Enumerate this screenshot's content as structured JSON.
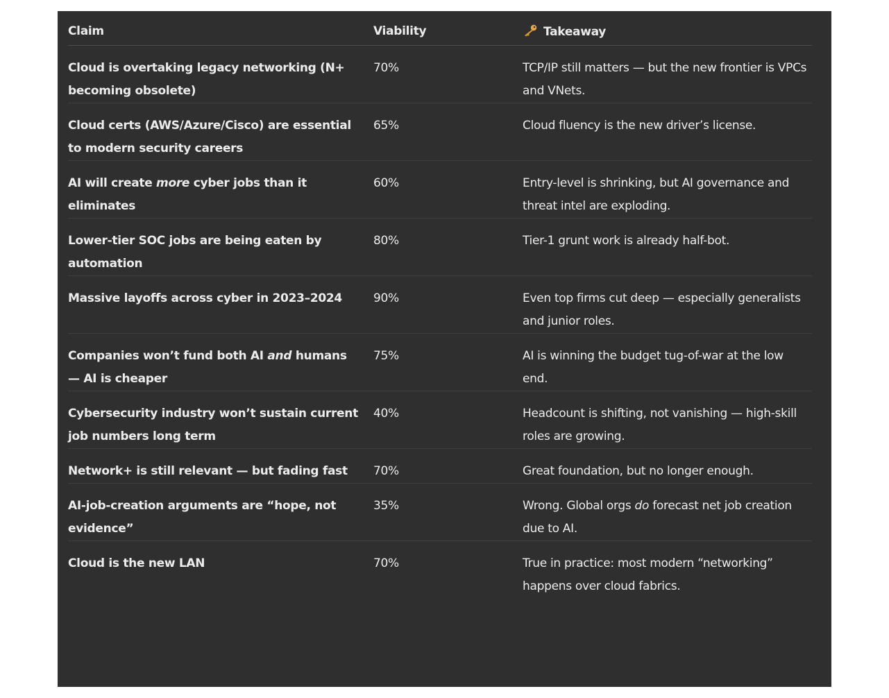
{
  "header": {
    "claim": "Claim",
    "viability": "Viability",
    "takeaway": "Takeaway",
    "takeaway_icon": "key-icon"
  },
  "rows": [
    {
      "claim": "Cloud is overtaking legacy networking (N+ becoming obsolete)",
      "viability": "70%",
      "takeaway": "TCP/IP still matters — but the new frontier is VPCs and VNets."
    },
    {
      "claim": "Cloud certs (AWS/Azure/Cisco) are essential to modern security careers",
      "viability": "65%",
      "takeaway": "Cloud fluency is the new driver’s license."
    },
    {
      "claim_pre": "AI will create ",
      "claim_em": "more",
      "claim_post": " cyber jobs than it eliminates",
      "viability": "60%",
      "takeaway": "Entry-level is shrinking, but AI governance and threat intel are exploding."
    },
    {
      "claim": "Lower-tier SOC jobs are being eaten by automation",
      "viability": "80%",
      "takeaway": "Tier-1 grunt work is already half-bot."
    },
    {
      "claim": "Massive layoffs across cyber in 2023–2024",
      "viability": "90%",
      "takeaway": "Even top firms cut deep — especially generalists and junior roles."
    },
    {
      "claim_pre": "Companies won’t fund both AI ",
      "claim_em": "and",
      "claim_post": " humans — AI is cheaper",
      "viability": "75%",
      "takeaway": "AI is winning the budget tug-of-war at the low end."
    },
    {
      "claim": "Cybersecurity industry won’t sustain current job numbers long term",
      "viability": "40%",
      "takeaway": "Headcount is shifting, not vanishing — high-skill roles are growing."
    },
    {
      "claim": "Network+ is still relevant — but fading fast",
      "viability": "70%",
      "takeaway": "Great foundation, but no longer enough."
    },
    {
      "claim": "AI-job-creation arguments are “hope, not evidence”",
      "viability": "35%",
      "takeaway_pre": "Wrong. Global orgs ",
      "takeaway_em": "do",
      "takeaway_post": " forecast net job creation due to AI."
    },
    {
      "claim": "Cloud is the new LAN",
      "viability": "70%",
      "takeaway": "True in practice: most modern “networking” happens over cloud fabrics."
    }
  ],
  "colors": {
    "panel_background": "#2f2f2f",
    "text": "#ececec",
    "key_icon": "#e8a84a"
  }
}
